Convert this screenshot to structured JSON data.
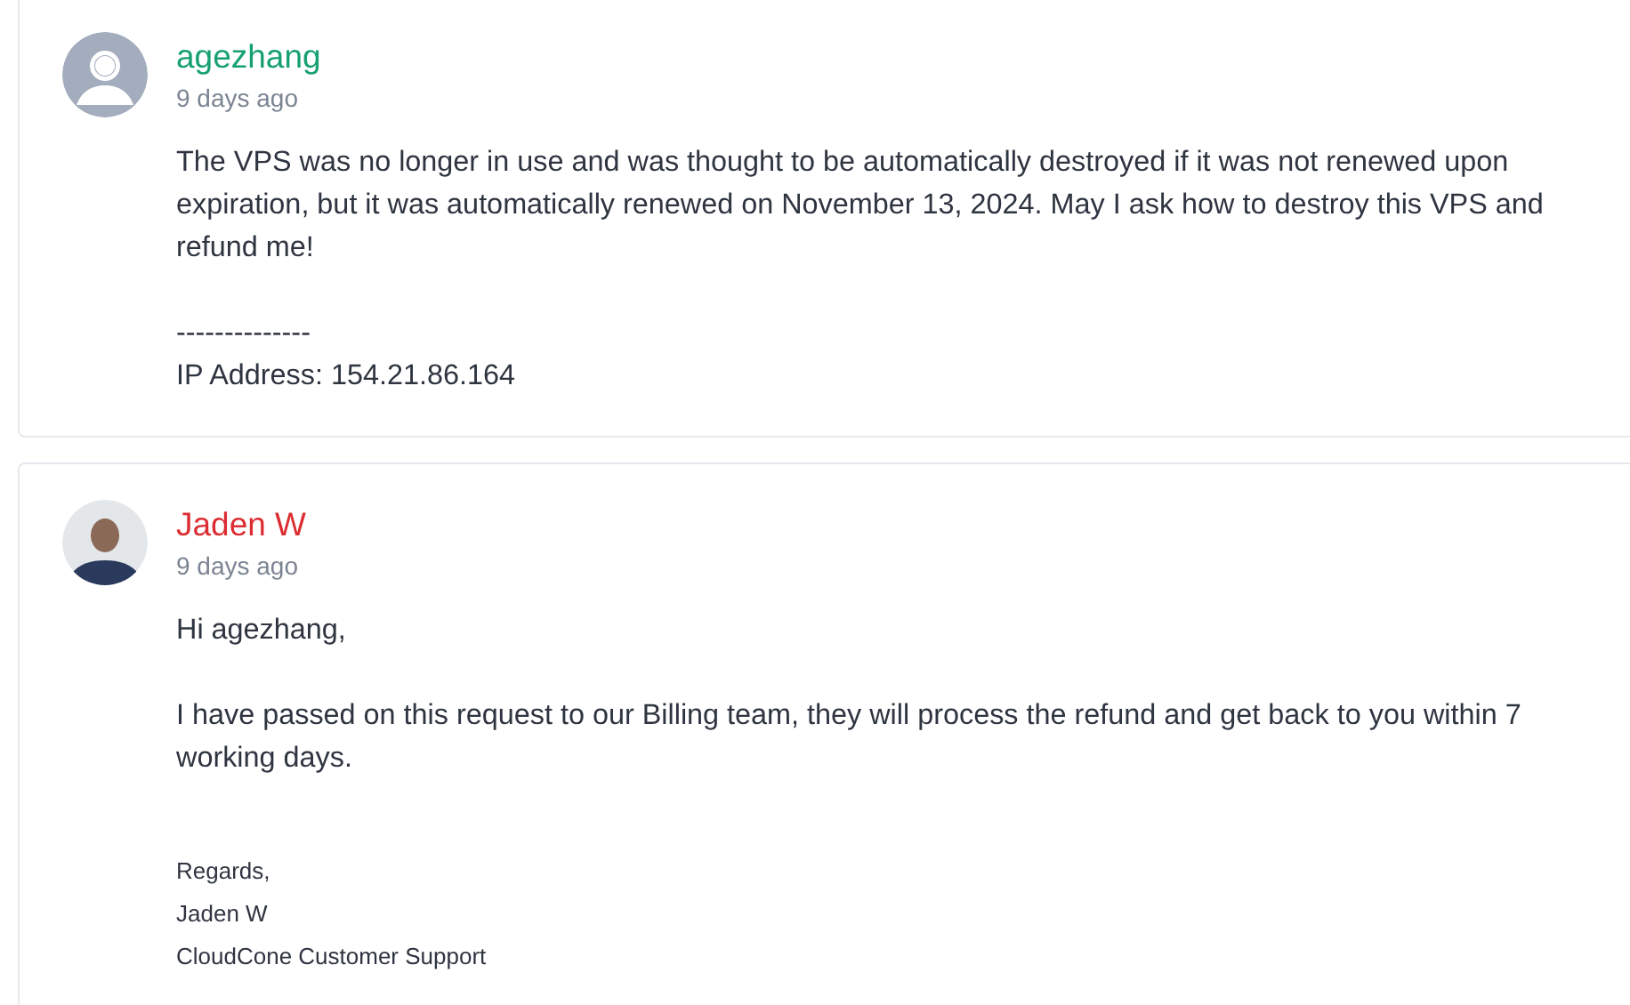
{
  "messages": [
    {
      "author": "agezhang",
      "kind": "customer",
      "time": "9 days ago",
      "blocks": [
        {
          "kind": "text",
          "text": "The VPS was no longer in use and was thought to be automatically destroyed if it was not renewed upon expiration, but it was automatically renewed on November 13, 2024. May I ask how to destroy this VPS and refund me!"
        },
        {
          "kind": "text",
          "text": "--------------\nIP Address: 154.21.86.164"
        }
      ]
    },
    {
      "author": "Jaden W",
      "kind": "staff",
      "time": "9 days ago",
      "blocks": [
        {
          "kind": "text",
          "text": "Hi agezhang,"
        },
        {
          "kind": "text",
          "text": "I have passed on this request to our Billing team, they will process the refund and get back to you within 7 working days."
        },
        {
          "kind": "small",
          "text": "Regards,"
        },
        {
          "kind": "small",
          "text": "Jaden W"
        },
        {
          "kind": "small",
          "text": "CloudCone Customer Support"
        }
      ]
    }
  ]
}
